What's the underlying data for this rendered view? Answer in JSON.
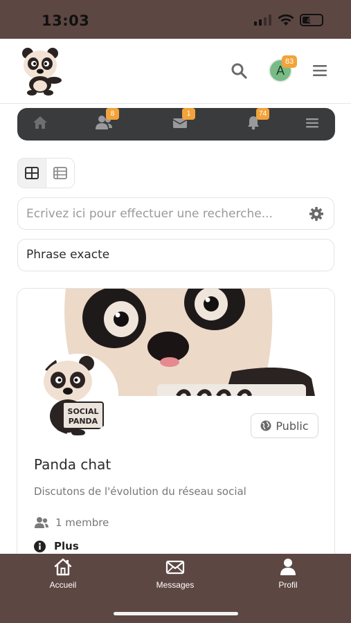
{
  "status_bar": {
    "time": "13:03",
    "battery": "48",
    "battery_level": 0.48
  },
  "header": {
    "logo_alt": "Social Panda",
    "avatar_initial": "A",
    "avatar_badge": "83",
    "icons": [
      "search-icon",
      "hamburger-menu-icon"
    ]
  },
  "nav": {
    "items": [
      {
        "icon": "home-icon",
        "badge": ""
      },
      {
        "icon": "friends-icon",
        "badge": "8"
      },
      {
        "icon": "envelope-icon",
        "badge": "1"
      },
      {
        "icon": "bell-icon",
        "badge": "74"
      },
      {
        "icon": "menu-icon",
        "badge": ""
      }
    ]
  },
  "view_toggle": {
    "options": [
      "grid-view",
      "list-view"
    ],
    "selected": "grid-view"
  },
  "search": {
    "placeholder": "Ecrivez ici pour effectuer une recherche...",
    "value": ""
  },
  "phrase_filter": {
    "value": "Phrase exacte"
  },
  "group_card": {
    "title": "Panda chat",
    "description": "Discutons de l'évolution du réseau social",
    "privacy": "Public",
    "members": "1 membre",
    "more_label": "Plus",
    "avatar_sign_text": "SOCIAL PANDA"
  },
  "tab_bar": {
    "tabs": [
      {
        "label": "Accueil",
        "icon": "home-outline-icon"
      },
      {
        "label": "Messages",
        "icon": "envelope-outline-icon"
      },
      {
        "label": "Profil",
        "icon": "user-icon"
      }
    ]
  },
  "colors": {
    "brand_brown": "#5d4743",
    "nav_dark": "#3a3b3d",
    "badge_orange": "#f2a33a",
    "avatar_green": "#78bb86"
  }
}
